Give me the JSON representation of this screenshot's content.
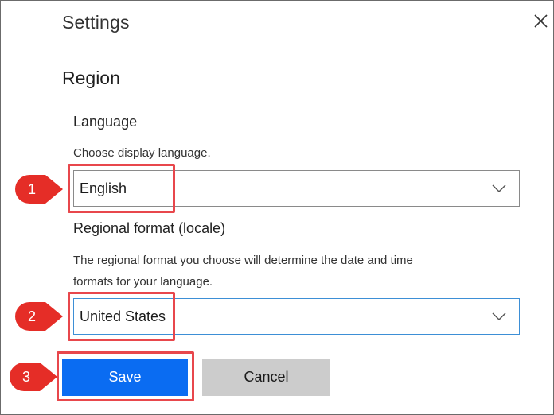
{
  "dialog": {
    "title": "Settings",
    "close_icon": "close-icon"
  },
  "region": {
    "heading": "Region",
    "language": {
      "label": "Language",
      "description": "Choose display language.",
      "selected": "English"
    },
    "regional_format": {
      "label": "Regional format (locale)",
      "description_line1": "The regional format you choose will determine the date and time",
      "description_line2": "formats for your language.",
      "selected": "United States"
    }
  },
  "buttons": {
    "save": "Save",
    "cancel": "Cancel"
  },
  "callouts": [
    "1",
    "2",
    "3"
  ],
  "colors": {
    "accent": "#0a6cf2",
    "highlight": "#e8474c",
    "badge": "#e52d27",
    "cancel_bg": "#cccccc"
  }
}
